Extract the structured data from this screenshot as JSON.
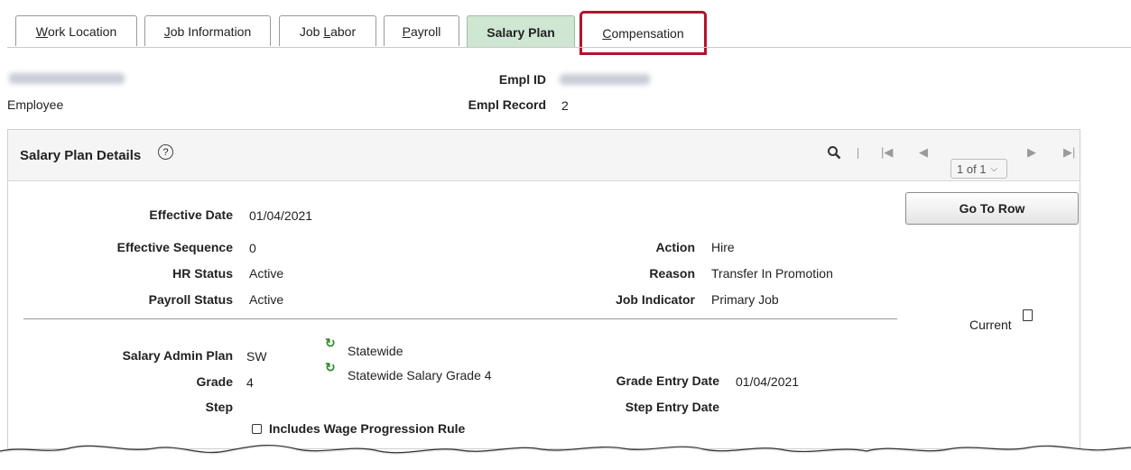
{
  "tabs": [
    {
      "label": "Work Location",
      "underline": "W",
      "rest": "ork Location"
    },
    {
      "label": "Job Information",
      "underline": "J",
      "rest": "ob Information"
    },
    {
      "label": "Job Labor",
      "pre": "Job ",
      "underline": "L",
      "rest": "abor"
    },
    {
      "label": "Payroll",
      "underline": "P",
      "rest": "ayroll"
    },
    {
      "label": "Salary Plan"
    },
    {
      "label": "Compensation",
      "underline": "C",
      "rest": "ompensation"
    }
  ],
  "header": {
    "employee_type": "Employee",
    "empl_id_label": "Empl ID",
    "empl_record_label": "Empl Record",
    "empl_record_value": "2"
  },
  "section": {
    "title": "Salary Plan Details",
    "help_icon": "help-circle-icon",
    "pager_label": "1 of 1",
    "go_to_row": "Go To Row"
  },
  "details": {
    "effective_date_label": "Effective Date",
    "effective_date_value": "01/04/2021",
    "effective_sequence_label": "Effective Sequence",
    "effective_sequence_value": "0",
    "hr_status_label": "HR Status",
    "hr_status_value": "Active",
    "payroll_status_label": "Payroll Status",
    "payroll_status_value": "Active",
    "action_label": "Action",
    "action_value": "Hire",
    "reason_label": "Reason",
    "reason_value": "Transfer In Promotion",
    "job_indicator_label": "Job Indicator",
    "job_indicator_value": "Primary Job",
    "current_label": "Current"
  },
  "salary": {
    "plan_label": "Salary Admin Plan",
    "plan_value": "SW",
    "plan_desc": "Statewide",
    "grade_label": "Grade",
    "grade_value": "4",
    "grade_desc": "Statewide Salary Grade 4",
    "grade_entry_label": "Grade Entry Date",
    "grade_entry_value": "01/04/2021",
    "step_label": "Step",
    "step_entry_label": "Step Entry Date",
    "wage_rule_label": "Includes Wage Progression Rule"
  },
  "colors": {
    "active_tab": "#cfe7d2",
    "highlight": "#b3132c",
    "refresh_icon": "#2e8b2e"
  }
}
